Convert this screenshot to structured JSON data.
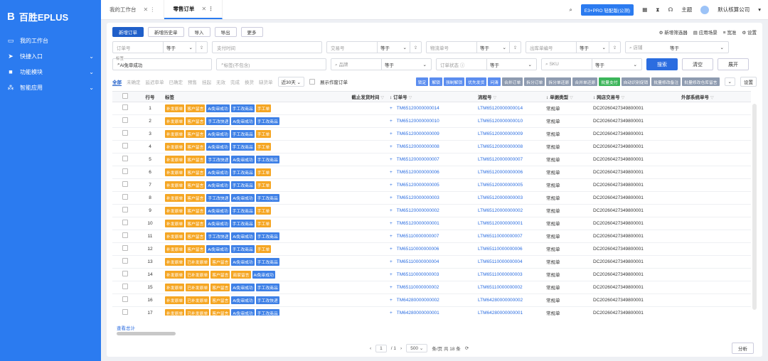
{
  "sidebar": {
    "logo_mark": "B",
    "logo_text": "百胜EPLUS",
    "items": [
      {
        "label": "我的工作台",
        "icon": "monitor-icon"
      },
      {
        "label": "快捷入口",
        "icon": "send-icon"
      },
      {
        "label": "功能模块",
        "icon": "folder-icon"
      },
      {
        "label": "智能应用",
        "icon": "apps-icon"
      }
    ]
  },
  "topbar": {
    "tabs": [
      {
        "label": "我的工作台"
      },
      {
        "label": "零售订单"
      }
    ],
    "pro_label": "E3+PRO 轻配版(公测)",
    "theme_label": "主题",
    "company_label": "默认核算公司"
  },
  "toolbar": {
    "buttons": [
      "新增订单",
      "新增历史单",
      "导入",
      "导出",
      "更多"
    ],
    "links": [
      "新增筛选器",
      "应用场景",
      "宽准",
      "设置"
    ]
  },
  "filters": {
    "row1": [
      {
        "label": "订单号",
        "op": "等于"
      },
      {
        "label": "支付时间",
        "op": ""
      },
      {
        "label": "交易号",
        "op": "等于"
      },
      {
        "label": "物流单号",
        "op": "等于"
      },
      {
        "label": "出库单编号",
        "op": "等于"
      },
      {
        "label": "店铺",
        "op": "等于"
      }
    ],
    "row2": {
      "tag_label": "标签",
      "tag_value": "Ai免审成功",
      "tag_exclude": "标签(不包含)",
      "brand": "品牌",
      "brand_op": "等于",
      "status": "订单状态",
      "status_op": "等于",
      "sku": "SKU",
      "sku_op": "等于",
      "search": "搜索",
      "clear": "清空",
      "expand": "展开"
    }
  },
  "status_tabs": [
    "全部",
    "未确定",
    "延迟审单",
    "已确定",
    "预售",
    "挂起",
    "无效",
    "完成",
    "换货",
    "缺货单"
  ],
  "days_label": "近30天",
  "show_invalid_label": "展示作废订单",
  "action_buttons": [
    {
      "label": "锁定",
      "color": "blue"
    },
    {
      "label": "解锁",
      "color": "blue"
    },
    {
      "label": "强制解锁",
      "color": "blue"
    },
    {
      "label": "优先发货",
      "color": "blue"
    },
    {
      "label": "问清",
      "color": "blue"
    },
    {
      "label": "合并订单",
      "color": "grey"
    },
    {
      "label": "拆分订单",
      "color": "grey"
    },
    {
      "label": "拆分单还原",
      "color": "grey"
    },
    {
      "label": "合并单还原",
      "color": "grey"
    },
    {
      "label": "批量支付",
      "color": "green"
    },
    {
      "label": "自动识别促销",
      "color": "grey"
    },
    {
      "label": "批量修改备注",
      "color": "grey"
    },
    {
      "label": "批量修改仓库留言",
      "color": "grey"
    }
  ],
  "settings_label": "设置",
  "table": {
    "headers": [
      "行号",
      "标签",
      "截止发货时间",
      "订单号",
      "流程号",
      "单据类型",
      "网店交易号",
      "外部系统单号"
    ],
    "rows": [
      {
        "no": "1",
        "tags": [
          "补发原单",
          "客户留言",
          "Ai免审成功",
          "手工改商品",
          "手工单"
        ],
        "order": "TM65120000000014",
        "flow": "LTM65120000000014",
        "type": "常规单",
        "trade": "DC20260427349800001"
      },
      {
        "no": "2",
        "tags": [
          "补发原单",
          "客户留言",
          "手工改快递",
          "Ai免审成功",
          "手工改商品"
        ],
        "order": "TM65120000000010",
        "flow": "LTM65120000000010",
        "type": "常规单",
        "trade": "DC20260427349800001"
      },
      {
        "no": "3",
        "tags": [
          "补发原单",
          "客户留言",
          "Ai免审成功",
          "手工改商品",
          "手工单"
        ],
        "order": "TM65120000000009",
        "flow": "LTM65120000000009",
        "type": "常规单",
        "trade": "DC20260427349800001"
      },
      {
        "no": "4",
        "tags": [
          "补发原单",
          "客户留言",
          "Ai免审成功",
          "手工改商品",
          "手工单"
        ],
        "order": "TM65120000000008",
        "flow": "LTM65120000000008",
        "type": "常规单",
        "trade": "DC20260427349800001"
      },
      {
        "no": "5",
        "tags": [
          "补发原单",
          "客户留言",
          "手工改快递",
          "Ai免审成功",
          "手工改商品"
        ],
        "order": "TM65120000000007",
        "flow": "LTM65120000000007",
        "type": "常规单",
        "trade": "DC20260427349800001"
      },
      {
        "no": "6",
        "tags": [
          "补发原单",
          "客户留言",
          "Ai免审成功",
          "手工改商品",
          "手工单"
        ],
        "order": "TM65120000000006",
        "flow": "LTM65120000000006",
        "type": "常规单",
        "trade": "DC20260427349800001"
      },
      {
        "no": "7",
        "tags": [
          "补发原单",
          "客户留言",
          "Ai免审成功",
          "手工改商品",
          "手工单"
        ],
        "order": "TM65120000000005",
        "flow": "LTM65120000000005",
        "type": "常规单",
        "trade": "DC20260427349800001"
      },
      {
        "no": "8",
        "tags": [
          "补发原单",
          "客户留言",
          "手工改快递",
          "Ai免审成功",
          "手工改商品"
        ],
        "order": "TM65120000000003",
        "flow": "LTM65120000000003",
        "type": "常规单",
        "trade": "DC20260427349800001"
      },
      {
        "no": "9",
        "tags": [
          "补发原单",
          "客户留言",
          "Ai免审成功",
          "手工改商品",
          "手工单"
        ],
        "order": "TM65120000000002",
        "flow": "LTM65120000000002",
        "type": "常规单",
        "trade": "DC20260427349800001"
      },
      {
        "no": "10",
        "tags": [
          "补发原单",
          "客户留言",
          "Ai免审成功",
          "手工改商品",
          "手工单"
        ],
        "order": "TM65120000000001",
        "flow": "LTM65120000000001",
        "type": "常规单",
        "trade": "DC20260427349800001"
      },
      {
        "no": "11",
        "tags": [
          "补发原单",
          "客户留言",
          "手工改快递",
          "Ai免审成功",
          "手工改商品"
        ],
        "order": "TM65110000000007",
        "flow": "LTM65110000000007",
        "type": "常规单",
        "trade": "DC20260427349800001"
      },
      {
        "no": "12",
        "tags": [
          "补发原单",
          "客户留言",
          "Ai免审成功",
          "手工改商品",
          "手工单"
        ],
        "order": "TM65110000000006",
        "flow": "LTM65110000000006",
        "type": "常规单",
        "trade": "DC20260427349800001"
      },
      {
        "no": "13",
        "tags": [
          "补发原单",
          "已补发原单",
          "客户留言",
          "Ai免审成功",
          "手工改商品"
        ],
        "order": "TM65110000000004",
        "flow": "LTM65110000000004",
        "type": "常规单",
        "trade": "DC20260427349800001"
      },
      {
        "no": "14",
        "tags": [
          "补发原单",
          "已补发原单",
          "客户留言",
          "商家留言",
          "Ai免审成功"
        ],
        "order": "TM65110000000003",
        "flow": "LTM65110000000003",
        "type": "常规单",
        "trade": "DC20260427349800001"
      },
      {
        "no": "15",
        "tags": [
          "补发原单",
          "已补发原单",
          "客户留言",
          "Ai免审成功",
          "手工改商品"
        ],
        "order": "TM65110000000002",
        "flow": "LTM65110000000002",
        "type": "常规单",
        "trade": "DC20260427349800001"
      },
      {
        "no": "16",
        "tags": [
          "补发原单",
          "已补发原单",
          "客户留言",
          "Ai免审成功",
          "手工改快递"
        ],
        "order": "TM64280000000002",
        "flow": "LTM64280000000002",
        "type": "常规单",
        "trade": "DC20260427349800001"
      },
      {
        "no": "17",
        "tags": [
          "补发原单",
          "已补发原单",
          "客户留言",
          "Ai免审成功",
          "手工改商品"
        ],
        "order": "TM64280000000001",
        "flow": "LTM64280000000001",
        "type": "常规单",
        "trade": "DC20260427349800001"
      }
    ]
  },
  "footer": {
    "summary_label": "查看总计",
    "page": "1",
    "page_total": "/ 1",
    "page_size": "500",
    "per_page_text": "条/页 共 18 条",
    "analyze_label": "分析"
  },
  "colors": {
    "accent": "#2b7bf0",
    "tag_orange": "#f5a623",
    "tag_blue": "#3e80e6",
    "link": "#2b6de0"
  }
}
